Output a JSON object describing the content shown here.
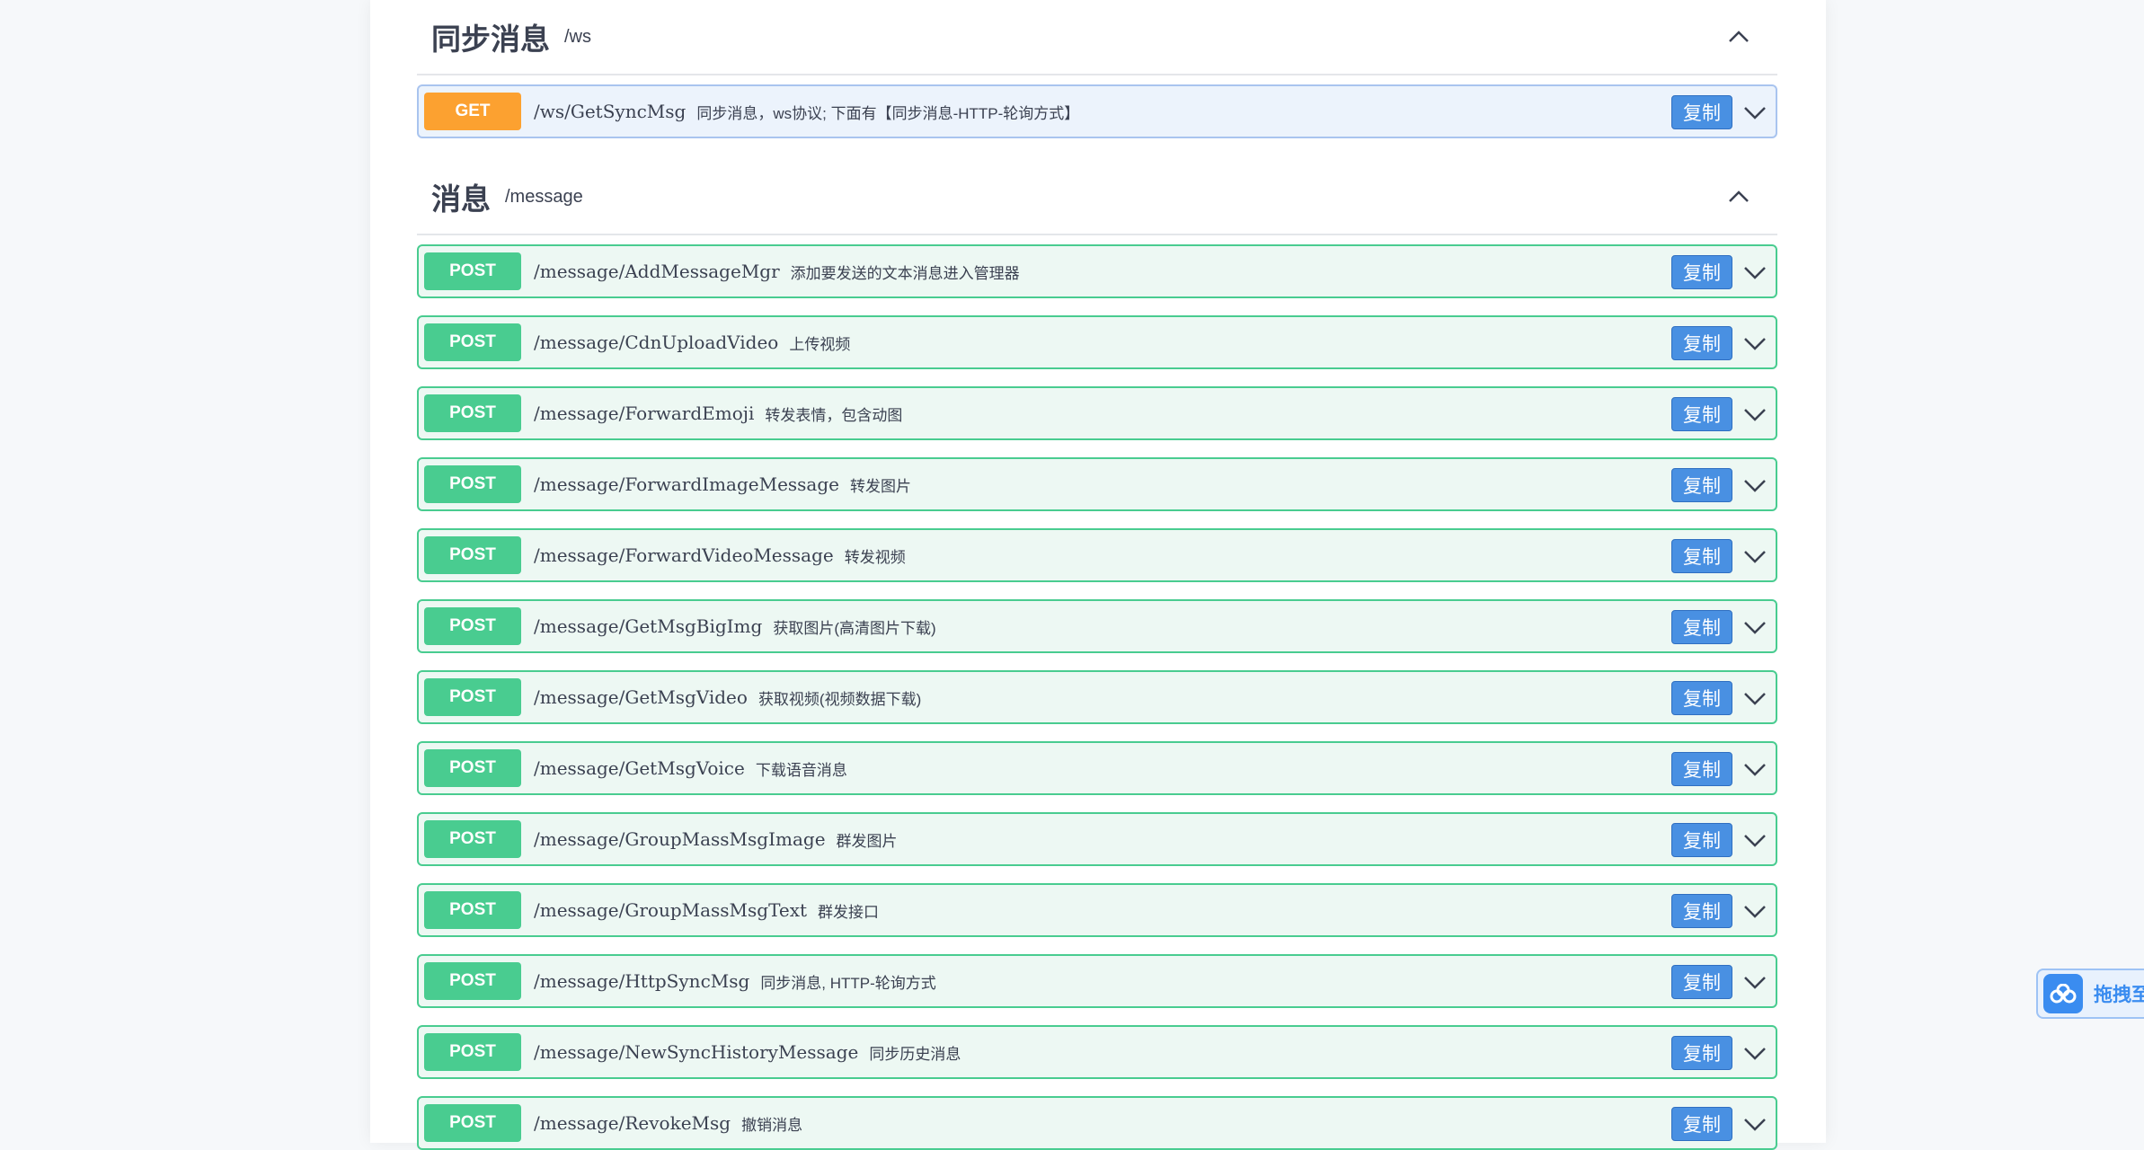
{
  "sections": [
    {
      "title": "同步消息",
      "path": "/ws",
      "operations": [
        {
          "method": "GET",
          "path": "/ws/GetSyncMsg",
          "desc": "同步消息，ws协议; 下面有【同步消息-HTTP-轮询方式】"
        }
      ]
    },
    {
      "title": "消息",
      "path": "/message",
      "operations": [
        {
          "method": "POST",
          "path": "/message/AddMessageMgr",
          "desc": "添加要发送的文本消息进入管理器"
        },
        {
          "method": "POST",
          "path": "/message/CdnUploadVideo",
          "desc": "上传视频"
        },
        {
          "method": "POST",
          "path": "/message/ForwardEmoji",
          "desc": "转发表情，包含动图"
        },
        {
          "method": "POST",
          "path": "/message/ForwardImageMessage",
          "desc": "转发图片"
        },
        {
          "method": "POST",
          "path": "/message/ForwardVideoMessage",
          "desc": "转发视频"
        },
        {
          "method": "POST",
          "path": "/message/GetMsgBigImg",
          "desc": "获取图片(高清图片下载)"
        },
        {
          "method": "POST",
          "path": "/message/GetMsgVideo",
          "desc": "获取视频(视频数据下载)"
        },
        {
          "method": "POST",
          "path": "/message/GetMsgVoice",
          "desc": "下载语音消息"
        },
        {
          "method": "POST",
          "path": "/message/GroupMassMsgImage",
          "desc": "群发图片"
        },
        {
          "method": "POST",
          "path": "/message/GroupMassMsgText",
          "desc": "群发接口"
        },
        {
          "method": "POST",
          "path": "/message/HttpSyncMsg",
          "desc": "同步消息, HTTP-轮询方式"
        },
        {
          "method": "POST",
          "path": "/message/NewSyncHistoryMessage",
          "desc": "同步历史消息"
        },
        {
          "method": "POST",
          "path": "/message/RevokeMsg",
          "desc": "撤销消息"
        }
      ]
    }
  ],
  "copy_label": "复制",
  "float_button": {
    "label": "拖拽至"
  },
  "icons": {
    "section_toggle": "chevron-up-icon",
    "op_toggle": "chevron-down-icon",
    "float": "cloud-icon"
  },
  "colors": {
    "post": "#49cc90",
    "get": "#fca130",
    "copy": "#4990e2"
  }
}
